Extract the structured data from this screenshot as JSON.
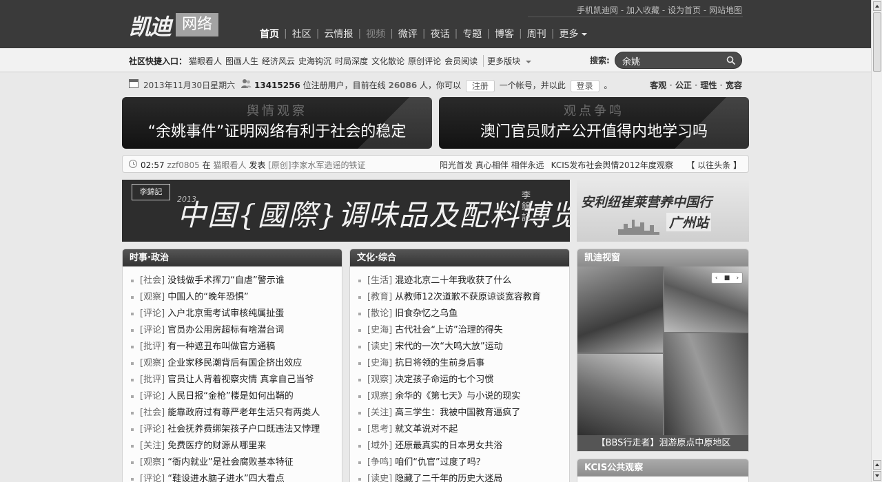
{
  "header": {
    "logo_text": "凯迪",
    "logo_box": "网络",
    "top_links": [
      "手机凯迪网",
      "加入收藏",
      "设为首页",
      "网站地图"
    ],
    "nav": [
      "首页",
      "社区",
      "云情报",
      "视频",
      "微评",
      "夜话",
      "专题",
      "博客",
      "周刊",
      "更多"
    ]
  },
  "quickbar": {
    "label": "社区快捷入口：",
    "items": [
      "猫眼看人",
      "图画人生",
      "经济风云",
      "史海钩沉",
      "时局深度",
      "文化散论",
      "原创评论",
      "会员阅读"
    ],
    "more": "更多版块",
    "search_label": "搜索:",
    "search_value": "余姚"
  },
  "info": {
    "date": "2013年11月30日星期六",
    "registered": "13415256",
    "text_registered": "位注册用户，目前在线",
    "online": "26086",
    "text_online": "人，你可以",
    "register_btn": "注册",
    "text_account": "一个帐号，并以此",
    "login_btn": "登录",
    "period": "。",
    "slogan": [
      "客观",
      "公正",
      "理性",
      "宽容"
    ]
  },
  "banners": [
    {
      "kicker": "舆情观察",
      "headline": "“余姚事件”证明网络有利于社会的稳定"
    },
    {
      "kicker": "观点争鸣",
      "headline": "澳门官员财产公开值得内地学习吗"
    }
  ],
  "ticker": {
    "time": "02:57",
    "user": "zzf0805",
    "at": "在",
    "board": "猫眼看人",
    "action": "发表",
    "post": "[原创]李家水军造谣的铁证",
    "links": [
      "阳光首发 真心相伴 相伴永远",
      "KCIS发布社会舆情2012年度观察"
    ],
    "past": "【 以往头条 】"
  },
  "ads": {
    "big_stamp": "李錦記",
    "big_year": "2013",
    "big_title": "中国{國際}调味品及配料博览",
    "big_sign": "李錦記",
    "small_title": "安利纽崔莱营养中国行",
    "small_city": "广州站"
  },
  "columns": [
    {
      "title": "时事·政治",
      "items": [
        {
          "tag": "[社会]",
          "text": "没钱做手术挥刀“自虐”警示谁"
        },
        {
          "tag": "[观察]",
          "text": "中国人的“晚年恐惧”"
        },
        {
          "tag": "[评论]",
          "text": "入户北京需考试审核纯属扯蛋"
        },
        {
          "tag": "[评论]",
          "text": "官员办公用房超标有啥潜台词"
        },
        {
          "tag": "[批评]",
          "text": "有一种遮丑布叫做官方通稿"
        },
        {
          "tag": "[观察]",
          "text": "企业家移民潮背后有国企挤出效应"
        },
        {
          "tag": "[批评]",
          "text": "官员让人背着视察灾情 真拿自己当爷"
        },
        {
          "tag": "[评论]",
          "text": "人民日报“金枪”楼是如何出鞘的"
        },
        {
          "tag": "[社会]",
          "text": "能靠政府过有尊严老年生活只有两类人"
        },
        {
          "tag": "[评论]",
          "text": "社会抚养费绑架孩子户口既违法又悖理"
        },
        {
          "tag": "[关注]",
          "text": "免费医疗的财源从哪里来"
        },
        {
          "tag": "[观察]",
          "text": "“衙内就业”是社会腐败基本特征"
        },
        {
          "tag": "[评论]",
          "text": "“鞋设进水脑子进水”四大看点"
        }
      ]
    },
    {
      "title": "文化·综合",
      "items": [
        {
          "tag": "[生活]",
          "text": "混迹北京二十年我收获了什么"
        },
        {
          "tag": "[教育]",
          "text": "从教师12次道歉不获原谅谈宽容教育"
        },
        {
          "tag": "[散论]",
          "text": "旧食杂忆之乌鱼"
        },
        {
          "tag": "[史海]",
          "text": "古代社会“上访”治理的得失"
        },
        {
          "tag": "[读史]",
          "text": "宋代的一次“大鸣大放”运动"
        },
        {
          "tag": "[史海]",
          "text": "抗日将领的生前身后事"
        },
        {
          "tag": "[观察]",
          "text": "决定孩子命运的七个习惯"
        },
        {
          "tag": "[观察]",
          "text": "余华的《第七天》与小说的现实"
        },
        {
          "tag": "[关注]",
          "text": "高三学生：我被中国教育逼疯了"
        },
        {
          "tag": "[思考]",
          "text": "就文革说对不起"
        },
        {
          "tag": "[域外]",
          "text": "还原最真实的日本男女共浴"
        },
        {
          "tag": "[争鸣]",
          "text": "咱们“仇官”过度了吗？"
        },
        {
          "tag": "[读史]",
          "text": "隐藏了二千年的历史大迷局"
        }
      ]
    }
  ],
  "side": {
    "title": "凯迪视窗",
    "caption": "【BBS行走者】洄游原点中原地区",
    "title2": "KCIS公共观察"
  }
}
